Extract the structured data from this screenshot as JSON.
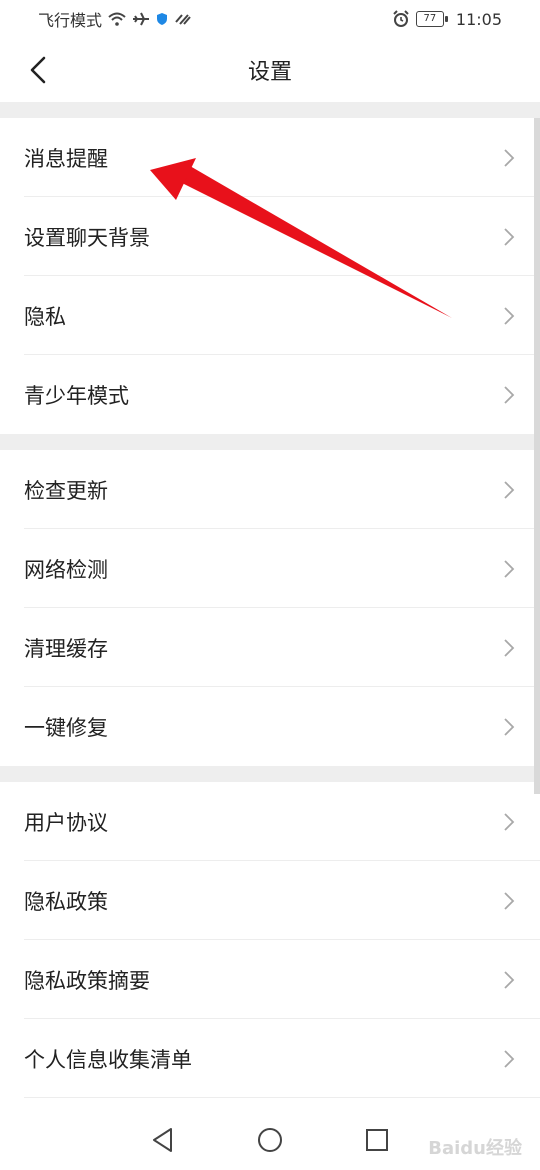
{
  "status_bar": {
    "left_text": "飞行模式",
    "battery": "77",
    "time": "11:05"
  },
  "header": {
    "title": "设置"
  },
  "groups": [
    {
      "items": [
        {
          "label": "消息提醒"
        },
        {
          "label": "设置聊天背景"
        },
        {
          "label": "隐私"
        },
        {
          "label": "青少年模式"
        }
      ]
    },
    {
      "items": [
        {
          "label": "检查更新"
        },
        {
          "label": "网络检测"
        },
        {
          "label": "清理缓存"
        },
        {
          "label": "一键修复"
        }
      ]
    },
    {
      "items": [
        {
          "label": "用户协议"
        },
        {
          "label": "隐私政策"
        },
        {
          "label": "隐私政策摘要"
        },
        {
          "label": "个人信息收集清单"
        }
      ]
    }
  ],
  "watermark": "Baidu经验",
  "colors": {
    "annotation_arrow": "#e8111b",
    "section_gap": "#eeeeee"
  },
  "icons": {
    "back": "chevron-left-icon",
    "row": "chevron-right-icon",
    "nav": [
      "back-triangle-icon",
      "home-circle-icon",
      "recents-square-icon"
    ]
  }
}
